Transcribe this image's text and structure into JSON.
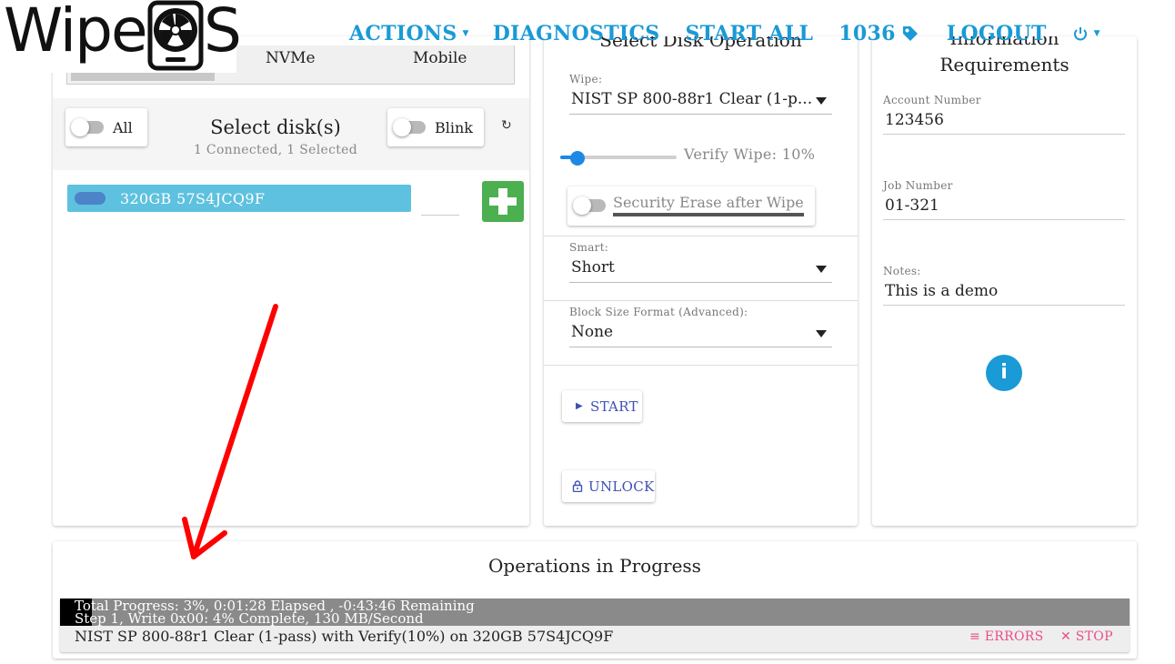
{
  "header": {
    "logo": {
      "text_prefix": "Wipe",
      "text_suffix": "S"
    },
    "nav": {
      "actions_label": "ACTIONS",
      "diagnostics_label": "DIAGNOSTICS",
      "start_all_label": "START ALL",
      "license_count": "1036",
      "logout_label": "LOGOUT"
    },
    "accent_color": "#1a9ad6"
  },
  "disk_panel": {
    "tabs": [
      "NVMe",
      "Mobile"
    ],
    "all_label": "All",
    "select_title": "Select disk(s)",
    "select_subtitle": "1 Connected, 1 Selected",
    "blink_label": "Blink",
    "disks": [
      {
        "label": "320GB 57S4JCQ9F",
        "selected": true
      }
    ]
  },
  "operation_panel": {
    "title": "Select Disk Operation",
    "wipe": {
      "label": "Wipe:",
      "value": "NIST SP 800-88r1 Clear (1-p..."
    },
    "verify": {
      "label": "Verify Wipe: 10%",
      "percent": 10
    },
    "security_erase_label": "Security Erase after Wipe",
    "smart": {
      "label": "Smart:",
      "value": "Short"
    },
    "block_size": {
      "label": "Block Size Format (Advanced):",
      "value": "None"
    },
    "start_label": "START",
    "unlock_label": "UNLOCK"
  },
  "info_panel": {
    "title_top": "Information",
    "title": "Requirements",
    "account": {
      "label": "Account Number",
      "value": "123456"
    },
    "job": {
      "label": "Job Number",
      "value": "01-321"
    },
    "notes": {
      "label": "Notes:",
      "value": "This is a demo"
    }
  },
  "operations": {
    "title": "Operations in Progress",
    "items": [
      {
        "progress_text": "Total Progress: 3%, 0:01:28 Elapsed , -0:43:46 Remaining",
        "step_text": "Step 1, Write 0x00: 4% Complete, 130 MB/Second",
        "progress_percent": 3,
        "description": "NIST SP 800-88r1 Clear (1-pass) with Verify(10%) on 320GB 57S4JCQ9F",
        "errors_label": "ERRORS",
        "stop_label": "STOP"
      }
    ]
  },
  "colors": {
    "disk_row": "#5ec1df",
    "add_button": "#4caf50",
    "link_blue": "#3f51b5",
    "danger_pink": "#e94e89",
    "annotation_arrow": "#ff0000"
  }
}
